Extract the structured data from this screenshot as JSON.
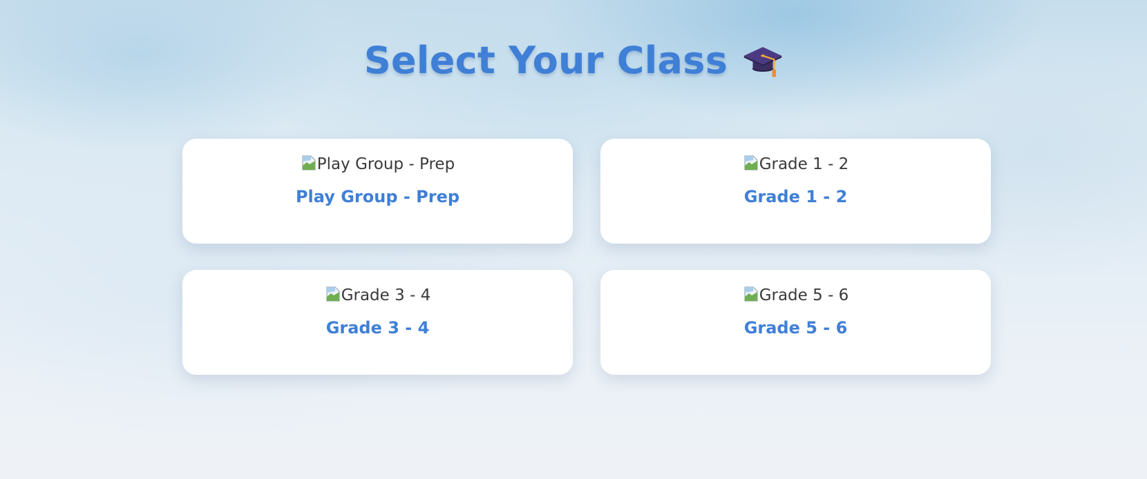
{
  "header": {
    "title": "Select Your Class",
    "title_icon": "graduation-cap-icon"
  },
  "colors": {
    "accent": "#3f7fd6",
    "card_background": "#ffffff",
    "alt_text": "#3a3a3a"
  },
  "classes": [
    {
      "image_alt": "Play Group - Prep",
      "label": "Play Group - Prep"
    },
    {
      "image_alt": "Grade 1 - 2",
      "label": "Grade 1 - 2"
    },
    {
      "image_alt": "Grade 3 - 4",
      "label": "Grade 3 - 4"
    },
    {
      "image_alt": "Grade 5 - 6",
      "label": "Grade 5 - 6"
    }
  ]
}
